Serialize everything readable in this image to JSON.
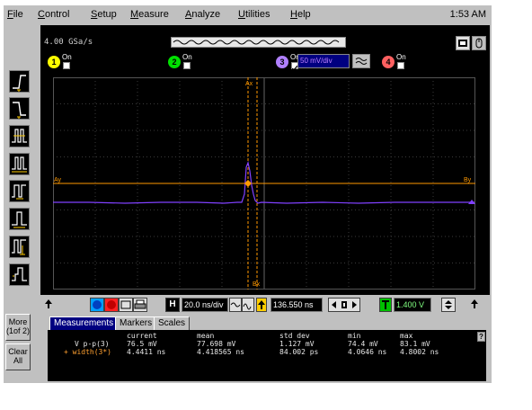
{
  "menu": {
    "items": [
      "File",
      "Control",
      "Setup",
      "Measure",
      "Analyze",
      "Utilities",
      "Help"
    ],
    "underline": [
      "F",
      "C",
      "S",
      "M",
      "A",
      "U",
      "H"
    ],
    "rest": [
      "ile",
      "ontrol",
      "etup",
      "easure",
      "nalyze",
      "tilities",
      "elp"
    ]
  },
  "clock": "1:53 AM",
  "sidebar": {
    "more_line1": "More",
    "more_line2": "(1of 2)",
    "clear_line1": "Clear",
    "clear_line2": "All",
    "trigger_icons": [
      "rising-edge-trigger-icon",
      "falling-edge-trigger-icon",
      "glitch-trigger-icon",
      "pulse-width-trigger-icon",
      "pattern-trigger-icon",
      "state-trigger-icon",
      "delay-trigger-icon",
      "tv-trigger-icon"
    ]
  },
  "scope": {
    "sample_rate": "4.00 GSa/s",
    "channels": [
      {
        "num": "1",
        "on_label": "On",
        "checked": false,
        "color": "#ffff00"
      },
      {
        "num": "2",
        "on_label": "On",
        "checked": false,
        "color": "#00e000"
      },
      {
        "num": "3",
        "on_label": "On",
        "checked": true,
        "color": "#b080ff",
        "scale": "50 mV/div"
      },
      {
        "num": "4",
        "on_label": "On",
        "checked": false,
        "color": "#ff6060"
      }
    ],
    "marker_labels": {
      "ax": "Ax",
      "bx": "Bx",
      "ay": "Ay",
      "by": "By"
    },
    "trace_color": "#8040ff",
    "marker_color": "#ff9900"
  },
  "controls": {
    "timebase": "20.0 ns/div",
    "delay": "136.550 ns",
    "trigger_level": "1.400 V"
  },
  "measurements": {
    "tabs": [
      "Measurements",
      "Markers",
      "Scales"
    ],
    "headers": [
      "current",
      "mean",
      "std dev",
      "min",
      "max"
    ],
    "rows": [
      {
        "label": "V p-p(3)",
        "values": [
          "76.5 mV",
          "77.698 mV",
          "1.127 mV",
          "74.4 mV",
          "83.1 mV"
        ]
      },
      {
        "label": "+ width(3*)",
        "values": [
          "4.4411 ns",
          "4.418565 ns",
          "84.002 ps",
          "4.0646 ns",
          "4.8002 ns"
        ]
      }
    ],
    "help_button": "?"
  }
}
